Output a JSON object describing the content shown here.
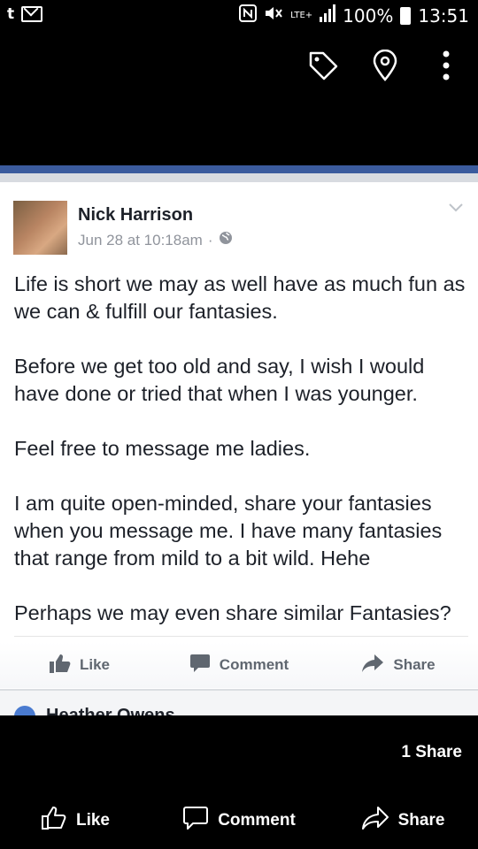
{
  "status_bar": {
    "left_icons": [
      "t-notification-icon",
      "mail-icon"
    ],
    "t_label": "t",
    "network": "LTE+",
    "battery": "100%",
    "time": "13:51"
  },
  "toolbar": {
    "icons": [
      "tag-icon",
      "location-pin-icon",
      "more-vert-icon"
    ]
  },
  "post": {
    "author": "Nick Harrison",
    "timestamp": "Jun 28 at 10:18am",
    "separator": "·",
    "paragraphs": [
      "Life is short we may as well have as much fun as we can & fulfill our fantasies.",
      "Before we get too old and say, I wish I would have done or tried that when I was younger.",
      "Feel free to message me ladies.",
      "I am quite open-minded, share your fantasies when you message me. I have many fantasies that range from mild to a bit wild. Hehe",
      "Perhaps we may even share similar Fantasies?"
    ],
    "actions": {
      "like": "Like",
      "comment": "Comment",
      "share": "Share"
    },
    "comment_peek_name": "Heather Owens"
  },
  "viewer": {
    "share_count": "1 Share",
    "like": "Like",
    "comment": "Comment",
    "share": "Share"
  },
  "colors": {
    "facebook_blue": "#3b5b9d",
    "text": "#1d2129",
    "meta": "#90949c",
    "action": "#606770"
  }
}
